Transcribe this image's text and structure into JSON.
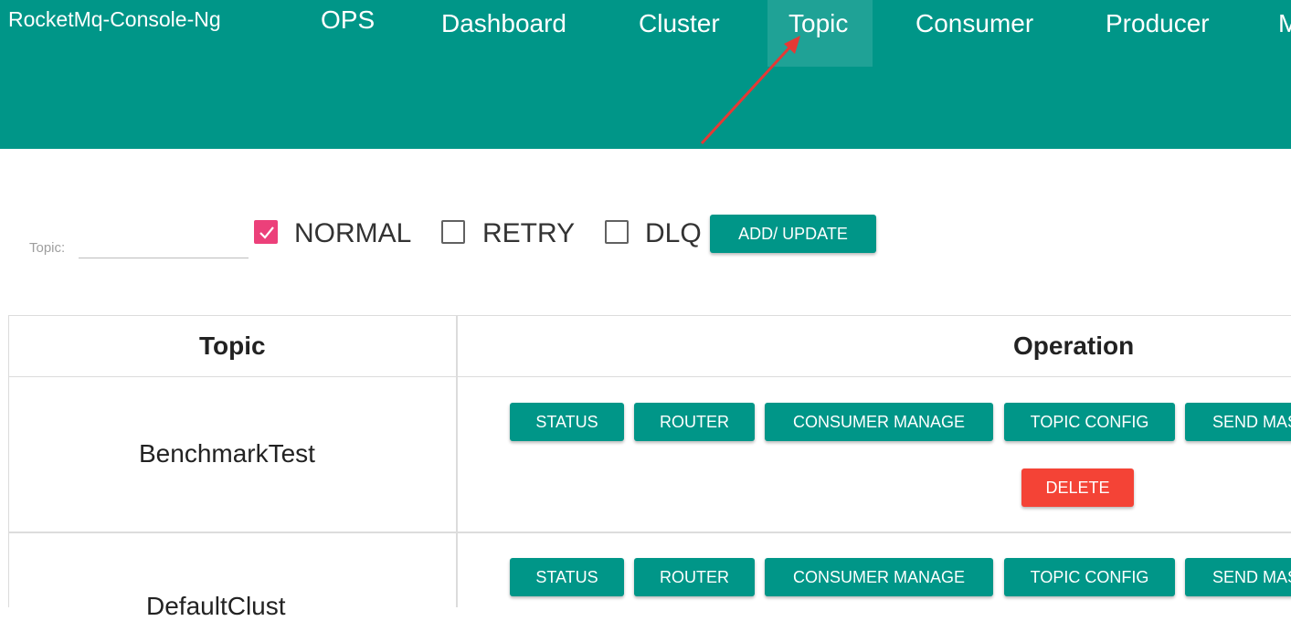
{
  "navbar": {
    "brand": "RocketMq-Console-Ng",
    "items": [
      {
        "label": "OPS"
      },
      {
        "label": "Dashboard"
      },
      {
        "label": "Cluster"
      },
      {
        "label": "Topic"
      },
      {
        "label": "Consumer"
      },
      {
        "label": "Producer"
      },
      {
        "label": "M"
      }
    ],
    "active": "Topic",
    "color": "#009688"
  },
  "filter": {
    "topic_label": "Topic:",
    "topic_value": "",
    "checkboxes": [
      {
        "label": "NORMAL",
        "checked": true
      },
      {
        "label": "RETRY",
        "checked": false
      },
      {
        "label": "DLQ",
        "checked": false
      }
    ],
    "add_update_label": "ADD/ UPDATE"
  },
  "table": {
    "headers": [
      "Topic",
      "Operation"
    ],
    "rows": [
      {
        "topic": "BenchmarkTest",
        "actions": [
          "STATUS",
          "ROUTER",
          "CONSUMER MANAGE",
          "TOPIC CONFIG",
          "SEND MAS"
        ],
        "delete": "DELETE"
      },
      {
        "topic": "DefaultClust",
        "actions": [
          "STATUS",
          "ROUTER",
          "CONSUMER MANAGE",
          "TOPIC CONFIG",
          "SEND MAS"
        ]
      }
    ]
  },
  "colors": {
    "primary": "#009688",
    "danger": "#f44336",
    "checkbox_checked": "#ec407a",
    "annotation_arrow": "#e53935"
  }
}
